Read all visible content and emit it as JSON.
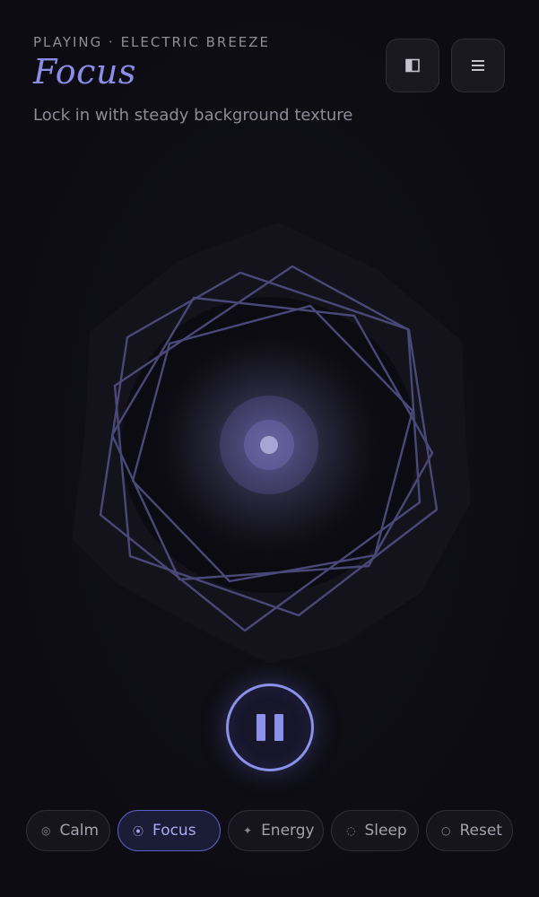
{
  "header": {
    "now_playing": "PLAYING · ELECTRIC BREEZE",
    "mode_title": "Focus",
    "mode_description": "Lock in with steady background texture"
  },
  "toolbar": {
    "layout_icon": "split-square-icon",
    "menu_icon": "hamburger-menu-icon"
  },
  "player": {
    "state": "playing",
    "control_icon": "pause-icon"
  },
  "presets": [
    {
      "label": "Calm",
      "glyph": "◎",
      "icon": "spiral-icon",
      "active": false
    },
    {
      "label": "Focus",
      "glyph": "⦿",
      "icon": "target-icon",
      "active": true
    },
    {
      "label": "Energy",
      "glyph": "✦",
      "icon": "sparkle-icon",
      "active": false
    },
    {
      "label": "Sleep",
      "glyph": "◌",
      "icon": "dotted-circle-icon",
      "active": false
    },
    {
      "label": "Reset",
      "glyph": "○",
      "icon": "circle-icon",
      "active": false
    }
  ],
  "colors": {
    "accent": "#8b90ea",
    "background": "#0e0d14",
    "text_muted": "#8d8b97"
  }
}
